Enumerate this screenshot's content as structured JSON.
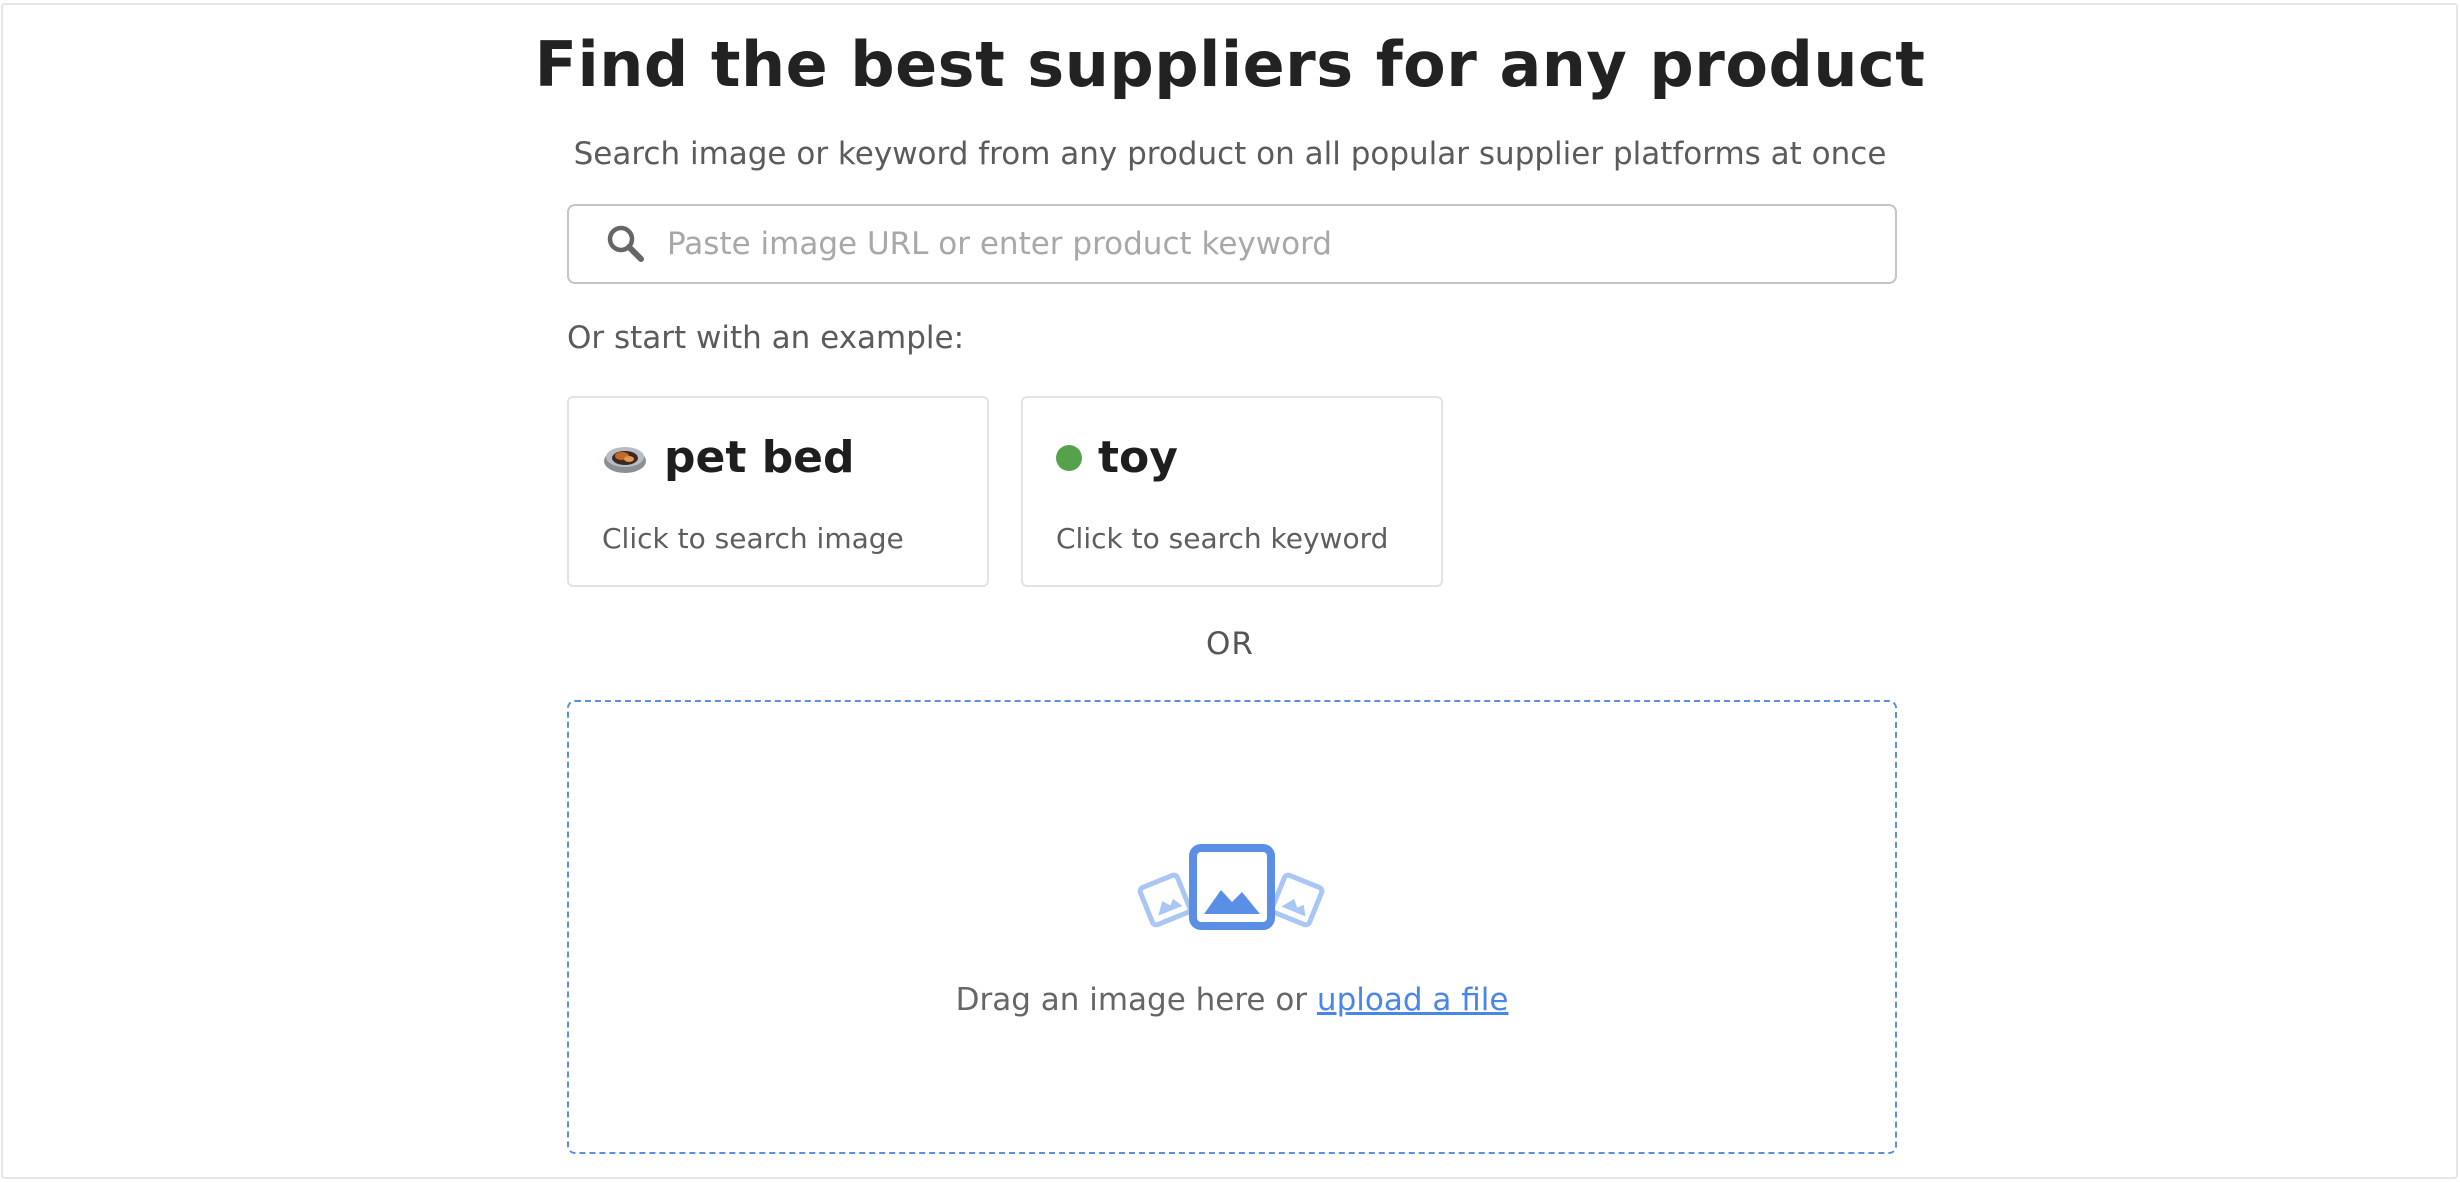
{
  "header": {
    "title": "Find the best suppliers for any product",
    "subtitle": "Search image or keyword from any product on all popular supplier platforms at once"
  },
  "search": {
    "placeholder": "Paste image URL or enter product keyword",
    "value": "",
    "icon": "search-icon"
  },
  "examples": {
    "label": "Or start with an example:",
    "items": [
      {
        "name": "pet bed",
        "hint": "Click to search image",
        "icon": "pet-bed-thumbnail"
      },
      {
        "name": "toy",
        "hint": "Click to search keyword",
        "icon": "green-dot",
        "color": "#55a24a"
      }
    ]
  },
  "divider": {
    "label": "OR"
  },
  "dropzone": {
    "text": "Drag an image here or ",
    "link": "upload a file",
    "icon": "image-upload-icon",
    "accent": "#4a86e8"
  }
}
